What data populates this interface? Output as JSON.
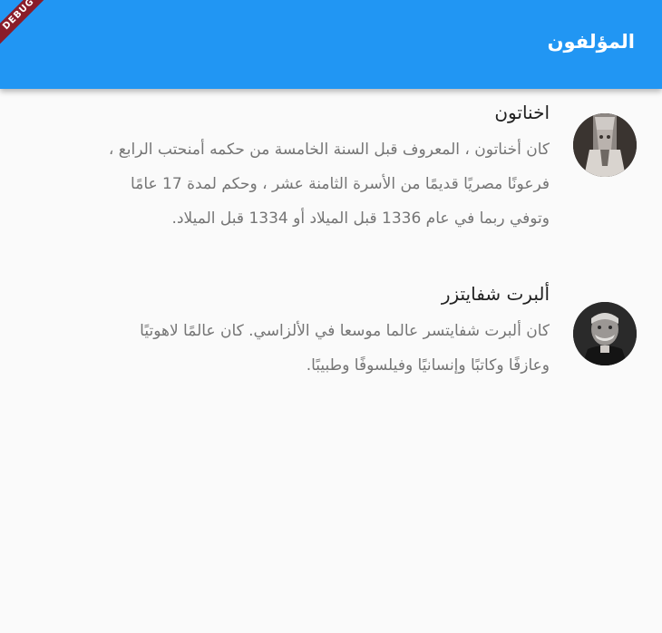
{
  "appbar": {
    "title": "المؤلفون",
    "debug_banner": "DEBUG",
    "color": "#2196f3"
  },
  "authors": [
    {
      "name": "اخناتون",
      "bio": "كان أخناتون ، المعروف قبل السنة الخامسة من حكمه أمنحتب الرابع ، فرعونًا مصريًا قديمًا من الأسرة الثامنة عشر ، وحكم لمدة 17 عامًا وتوفي ربما في عام 1336 قبل الميلاد أو 1334 قبل الميلاد."
    },
    {
      "name": "ألبرت شفايتزر",
      "bio": "كان ألبرت شفايتسر عالما موسعا في الألزاسي. كان عالمًا لاهوتيًا وعازفًا وكاتبًا وإنسانيًا وفيلسوفًا وطبيبًا."
    }
  ]
}
